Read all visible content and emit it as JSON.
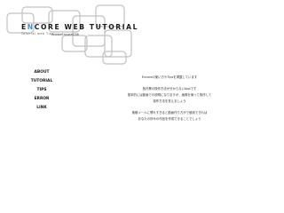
{
  "brand": {
    "title_first": "E",
    "title_accent": "N",
    "title_rest": "CORE WEB TUTORIAL",
    "tagline": "Tutorial web Tips",
    "sub": "AdobeEncoreCS6"
  },
  "nav": {
    "items": [
      {
        "label": "ABOUT"
      },
      {
        "label": "TUTORIAL"
      },
      {
        "label": "TIPS"
      },
      {
        "label": "ERROR"
      },
      {
        "label": "LINK"
      }
    ]
  },
  "main": {
    "paragraphs": [
      [
        "Encoreの使い方やTipsを掲載しています"
      ],
      [
        "各作業の操作方法が分からないAppです",
        "基本的には動画での説明になりますが、画像を使って操作して",
        "操作方法を覚えましょう"
      ],
      [
        "素敵ツールに慣れすぎると動画作り方がで使用できれば",
        "あなたの好みの作品を作成できることでしょう"
      ]
    ]
  },
  "colors": {
    "accent": "#3a8fd0",
    "deco_stroke": "#bfbfbf",
    "text": "#1a1a1a"
  }
}
